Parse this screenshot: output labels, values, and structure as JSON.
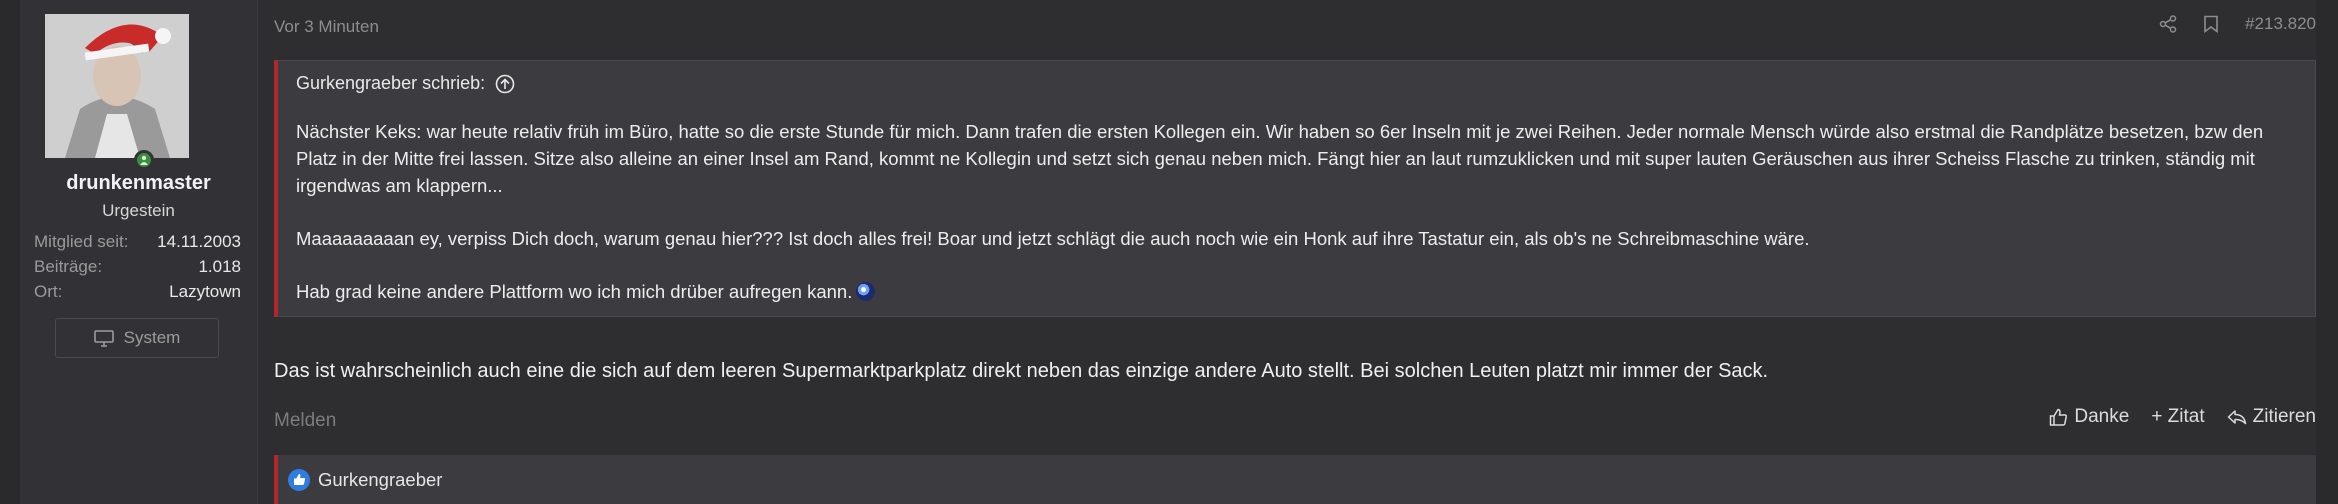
{
  "post": {
    "author": {
      "username": "drunkenmaster",
      "title": "Urgestein",
      "info": [
        {
          "key": "Mitglied seit:",
          "value": "14.11.2003"
        },
        {
          "key": "Beiträge:",
          "value": "1.018"
        },
        {
          "key": "Ort:",
          "value": "Lazytown"
        }
      ],
      "system_button": "System"
    },
    "timestamp": "Vor 3 Minuten",
    "post_number": "#213.820",
    "quote": {
      "header": "Gurkengraeber schrieb:",
      "paragraphs": [
        "Nächster Keks: war heute relativ früh im Büro, hatte so die erste Stunde für mich. Dann trafen die ersten Kollegen ein. Wir haben so 6er Inseln mit je zwei Reihen. Jeder normale Mensch würde also erstmal die Randplätze besetzen, bzw den Platz in der Mitte frei lassen. Sitze also alleine an einer Insel am Rand, kommt ne Kollegin und setzt sich genau neben mich. Fängt hier an laut rumzuklicken und mit super lauten Geräuschen aus ihrer Scheiss Flasche zu trinken, ständig mit irgendwas am klappern...",
        "Maaaaaaaaan ey, verpiss Dich doch, warum genau hier??? Ist doch alles frei! Boar und jetzt schlägt die auch noch wie ein Honk auf ihre Tastatur ein, als ob's ne Schreibmaschine wäre.",
        "Hab grad keine andere Plattform wo ich mich drüber aufregen kann."
      ]
    },
    "reply_text": "Das ist wahrscheinlich auch eine die sich auf dem leeren Supermarktparkplatz direkt neben das einzige andere Auto stellt. Bei solchen Leuten platzt mir immer der Sack.",
    "report_label": "Melden",
    "actions": {
      "like": "Danke",
      "quote": "+ Zitat",
      "reply": "Zitieren"
    },
    "reactions": {
      "users": "Gurkengraeber"
    }
  },
  "colors": {
    "background": "#2e2e31",
    "quote_border": "#b3262b",
    "like_badge": "#2f7de1",
    "online": "#3a8d3a"
  },
  "icons": [
    "user-online-icon",
    "monitor-icon",
    "arrow-up-circle-icon",
    "share-icon",
    "bookmark-icon",
    "thumbs-up-icon",
    "reply-icon",
    "like-reaction-icon",
    "emoji-icon"
  ]
}
